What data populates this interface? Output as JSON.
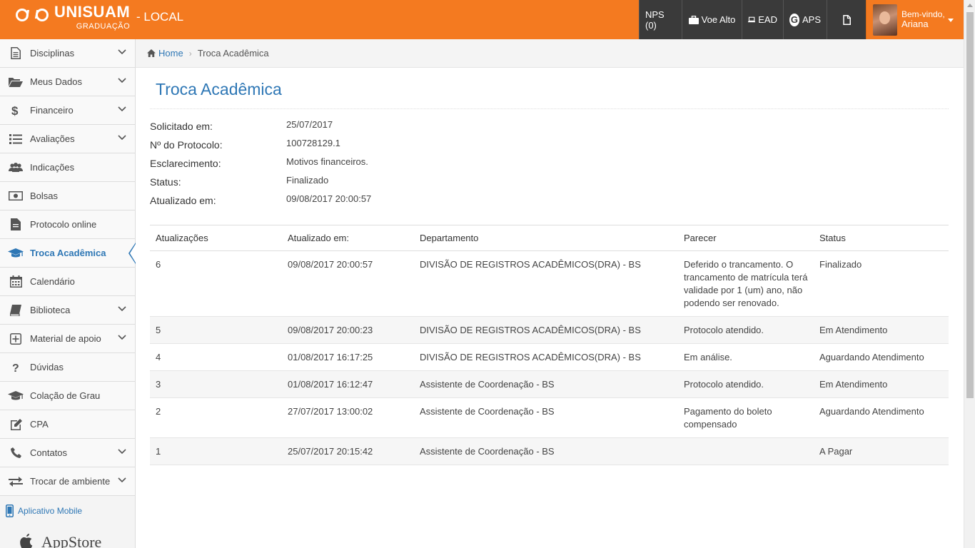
{
  "header": {
    "brand": "UNISUAM",
    "brand_sub": "GRADUAÇÃO",
    "environment": "- LOCAL",
    "nav": [
      {
        "label": "NPS (0)",
        "icon": ""
      },
      {
        "label": "Voe Alto",
        "icon": "briefcase-icon"
      },
      {
        "label": "EAD",
        "icon": "laptop-icon"
      },
      {
        "label": "APS",
        "icon": "g-circle-icon"
      },
      {
        "label": "",
        "icon": "document-icon"
      }
    ],
    "user": {
      "welcome": "Bem-vindo,",
      "name": "Ariana"
    },
    "colors": {
      "brand_orange": "#f47a20",
      "nav_dark": "#3a3a3a",
      "accent_blue": "#2e77b5"
    }
  },
  "sidebar": {
    "items": [
      {
        "label": "Disciplinas",
        "icon": "file-text-icon",
        "expandable": true
      },
      {
        "label": "Meus Dados",
        "icon": "folder-open-icon",
        "expandable": true
      },
      {
        "label": "Financeiro",
        "icon": "dollar-icon",
        "expandable": true
      },
      {
        "label": "Avaliações",
        "icon": "list-icon",
        "expandable": true
      },
      {
        "label": "Indicações",
        "icon": "users-icon",
        "expandable": false
      },
      {
        "label": "Bolsas",
        "icon": "money-icon",
        "expandable": false
      },
      {
        "label": "Protocolo online",
        "icon": "file-icon",
        "expandable": false
      },
      {
        "label": "Troca Acadêmica",
        "icon": "graduation-cap-icon",
        "expandable": false,
        "active": true
      },
      {
        "label": "Calendário",
        "icon": "calendar-icon",
        "expandable": false
      },
      {
        "label": "Biblioteca",
        "icon": "book-icon",
        "expandable": true
      },
      {
        "label": "Material de apoio",
        "icon": "plus-square-icon",
        "expandable": true
      },
      {
        "label": "Dúvidas",
        "icon": "question-icon",
        "expandable": false
      },
      {
        "label": "Colação de Grau",
        "icon": "graduation-cap-icon",
        "expandable": false
      },
      {
        "label": "CPA",
        "icon": "edit-icon",
        "expandable": false
      },
      {
        "label": "Contatos",
        "icon": "phone-icon",
        "expandable": true
      },
      {
        "label": "Trocar de ambiente",
        "icon": "exchange-icon",
        "expandable": true
      }
    ],
    "mobile_label": "Aplicativo Mobile",
    "appstore_label": "AppStore"
  },
  "breadcrumb": {
    "home": "Home",
    "current": "Troca Acadêmica"
  },
  "page": {
    "title": "Troca Acadêmica",
    "info": [
      {
        "label": "Solicitado em:",
        "value": "25/07/2017"
      },
      {
        "label": "Nº do Protocolo:",
        "value": "100728129.1"
      },
      {
        "label": "Esclarecimento:",
        "value": "Motivos financeiros."
      },
      {
        "label": "Status:",
        "value": "Finalizado"
      },
      {
        "label": "Atualizado em:",
        "value": "09/08/2017 20:00:57"
      }
    ],
    "table": {
      "headers": [
        "Atualizações",
        "Atualizado em:",
        "Departamento",
        "Parecer",
        "Status"
      ],
      "rows": [
        [
          "6",
          "09/08/2017 20:00:57",
          "DIVISÃO DE REGISTROS ACADÊMICOS(DRA) - BS",
          "Deferido o trancamento. O trancamento de matrícula terá validade por 1 (um) ano, não podendo ser renovado.",
          "Finalizado"
        ],
        [
          "5",
          "09/08/2017 20:00:23",
          "DIVISÃO DE REGISTROS ACADÊMICOS(DRA) - BS",
          "Protocolo atendido.",
          "Em Atendimento"
        ],
        [
          "4",
          "01/08/2017 16:17:25",
          "DIVISÃO DE REGISTROS ACADÊMICOS(DRA) - BS",
          "Em análise.",
          "Aguardando Atendimento"
        ],
        [
          "3",
          "01/08/2017 16:12:47",
          "Assistente de Coordenação - BS",
          "Protocolo atendido.",
          "Em Atendimento"
        ],
        [
          "2",
          "27/07/2017 13:00:02",
          "Assistente de Coordenação - BS",
          "Pagamento do boleto compensado",
          "Aguardando Atendimento"
        ],
        [
          "1",
          "25/07/2017 20:15:42",
          "Assistente de Coordenação - BS",
          "",
          "A Pagar"
        ]
      ]
    }
  }
}
